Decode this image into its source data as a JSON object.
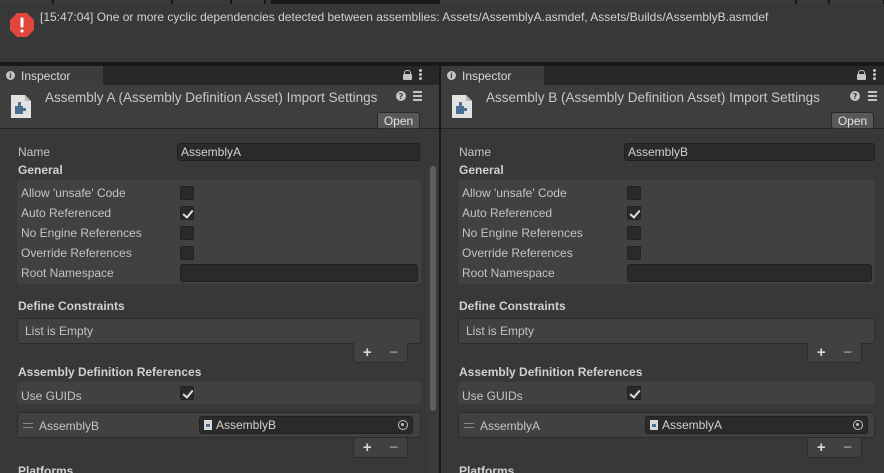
{
  "console": {
    "message": "[15:47:04] One or more cyclic dependencies detected between assemblies: Assets/AssemblyA.asmdef, Assets/Builds/AssemblyB.asmdef"
  },
  "panels": [
    {
      "tab_label": "Inspector",
      "header_title": "Assembly A (Assembly Definition Asset) Import Settings",
      "open_label": "Open",
      "name_label": "Name",
      "name_value": "AssemblyA",
      "general_label": "General",
      "options": [
        {
          "label": "Allow 'unsafe' Code",
          "checked": false
        },
        {
          "label": "Auto Referenced",
          "checked": true
        },
        {
          "label": "No Engine References",
          "checked": false
        },
        {
          "label": "Override References",
          "checked": false
        }
      ],
      "root_namespace_label": "Root Namespace",
      "root_namespace_value": "",
      "define_constraints_label": "Define Constraints",
      "list_empty": "List is Empty",
      "plus": "+",
      "minus": "−",
      "assembly_refs_label": "Assembly Definition References",
      "use_guids_label": "Use GUIDs",
      "use_guids_checked": true,
      "ref_item_label": "AssemblyB",
      "ref_item_value": "AssemblyB",
      "platforms_label": "Platforms"
    },
    {
      "tab_label": "Inspector",
      "header_title": "Assembly B (Assembly Definition Asset) Import Settings",
      "open_label": "Open",
      "name_label": "Name",
      "name_value": "AssemblyB",
      "general_label": "General",
      "options": [
        {
          "label": "Allow 'unsafe' Code",
          "checked": false
        },
        {
          "label": "Auto Referenced",
          "checked": true
        },
        {
          "label": "No Engine References",
          "checked": false
        },
        {
          "label": "Override References",
          "checked": false
        }
      ],
      "root_namespace_label": "Root Namespace",
      "root_namespace_value": "",
      "define_constraints_label": "Define Constraints",
      "list_empty": "List is Empty",
      "plus": "+",
      "minus": "−",
      "assembly_refs_label": "Assembly Definition References",
      "use_guids_label": "Use GUIDs",
      "use_guids_checked": true,
      "ref_item_label": "AssemblyA",
      "ref_item_value": "AssemblyA",
      "platforms_label": "Platforms"
    }
  ],
  "colors": {
    "error_red": "#e0463c",
    "asset_icon_blue": "#4a6f92",
    "panel_bg": "#383838"
  },
  "icons": [
    "error-icon",
    "info-icon",
    "lock-icon",
    "kebab-menu-icon",
    "assembly-definition-icon",
    "help-icon",
    "preset-settings-icon",
    "checkmark-icon",
    "drag-handle-icon",
    "object-picker-icon",
    "asset-file-icon"
  ]
}
